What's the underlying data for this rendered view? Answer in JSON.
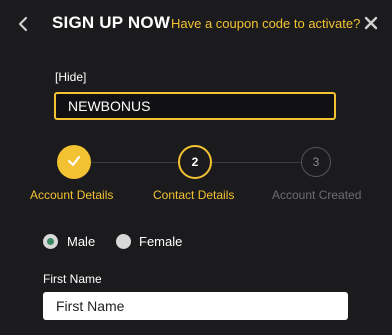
{
  "header": {
    "back_icon": "chevron-left-icon",
    "title": "SIGN UP NOW",
    "coupon_prompt": "Have a coupon code to activate?",
    "close_icon": "close-icon"
  },
  "coupon": {
    "hide_label": "[Hide]",
    "code_value": "NEWBONUS"
  },
  "steps": [
    {
      "number": "1",
      "label": "Account Details",
      "state": "completed",
      "icon": "check-icon"
    },
    {
      "number": "2",
      "label": "Contact Details",
      "state": "active"
    },
    {
      "number": "3",
      "label": "Account Created",
      "state": "pending"
    }
  ],
  "gender": {
    "options": [
      {
        "label": "Male",
        "selected": true
      },
      {
        "label": "Female",
        "selected": false
      }
    ]
  },
  "first_name": {
    "label": "First Name",
    "placeholder": "First Name",
    "value": ""
  },
  "colors": {
    "accent": "#f3c232",
    "background": "#1b1b1d",
    "radio_selected": "#3a8a64"
  }
}
